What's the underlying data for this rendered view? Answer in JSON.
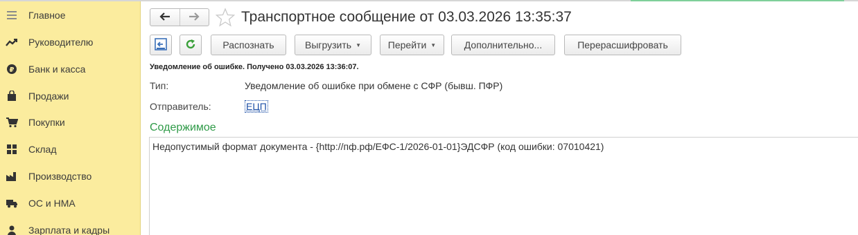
{
  "sidebar": {
    "items": [
      {
        "label": "Главное",
        "icon": "menu-lines-icon"
      },
      {
        "label": "Руководителю",
        "icon": "trend-chart-icon"
      },
      {
        "label": "Банк и касса",
        "icon": "coin-icon"
      },
      {
        "label": "Продажи",
        "icon": "shopping-bag-icon"
      },
      {
        "label": "Покупки",
        "icon": "cart-icon"
      },
      {
        "label": "Склад",
        "icon": "warehouse-icon"
      },
      {
        "label": "Производство",
        "icon": "factory-icon"
      },
      {
        "label": "ОС и НМА",
        "icon": "truck-icon"
      },
      {
        "label": "Зарплата и кадры",
        "icon": "person-icon"
      }
    ]
  },
  "header": {
    "title": "Транспортное сообщение от 03.03.2026 13:35:37"
  },
  "toolbar": {
    "recognize_label": "Распознать",
    "export_label": "Выгрузить",
    "goto_label": "Перейти",
    "more_label": "Дополнительно...",
    "redecrypt_label": "Перерасшифровать"
  },
  "message": {
    "notice": "Уведомление об ошибке. Получено 03.03.2026 13:36:07.",
    "type_label": "Тип:",
    "type_value": "Уведомление об ошибке при обмене с СФР (бывш. ПФР)",
    "sender_label": "Отправитель:",
    "sender_value": "ЕЦП",
    "content_heading": "Содержимое",
    "content_text": "Недопустимый формат документа - {http://пф.рф/ЕФС-1/2026-01-01}ЭДСФР (код ошибки: 07010421)"
  },
  "colors": {
    "sidebar_bg": "#fbec9e",
    "section_heading": "#2e9a47",
    "link": "#1b4ea6",
    "refresh_icon": "#3aa03a",
    "accent_line": "#7fcf9a"
  }
}
